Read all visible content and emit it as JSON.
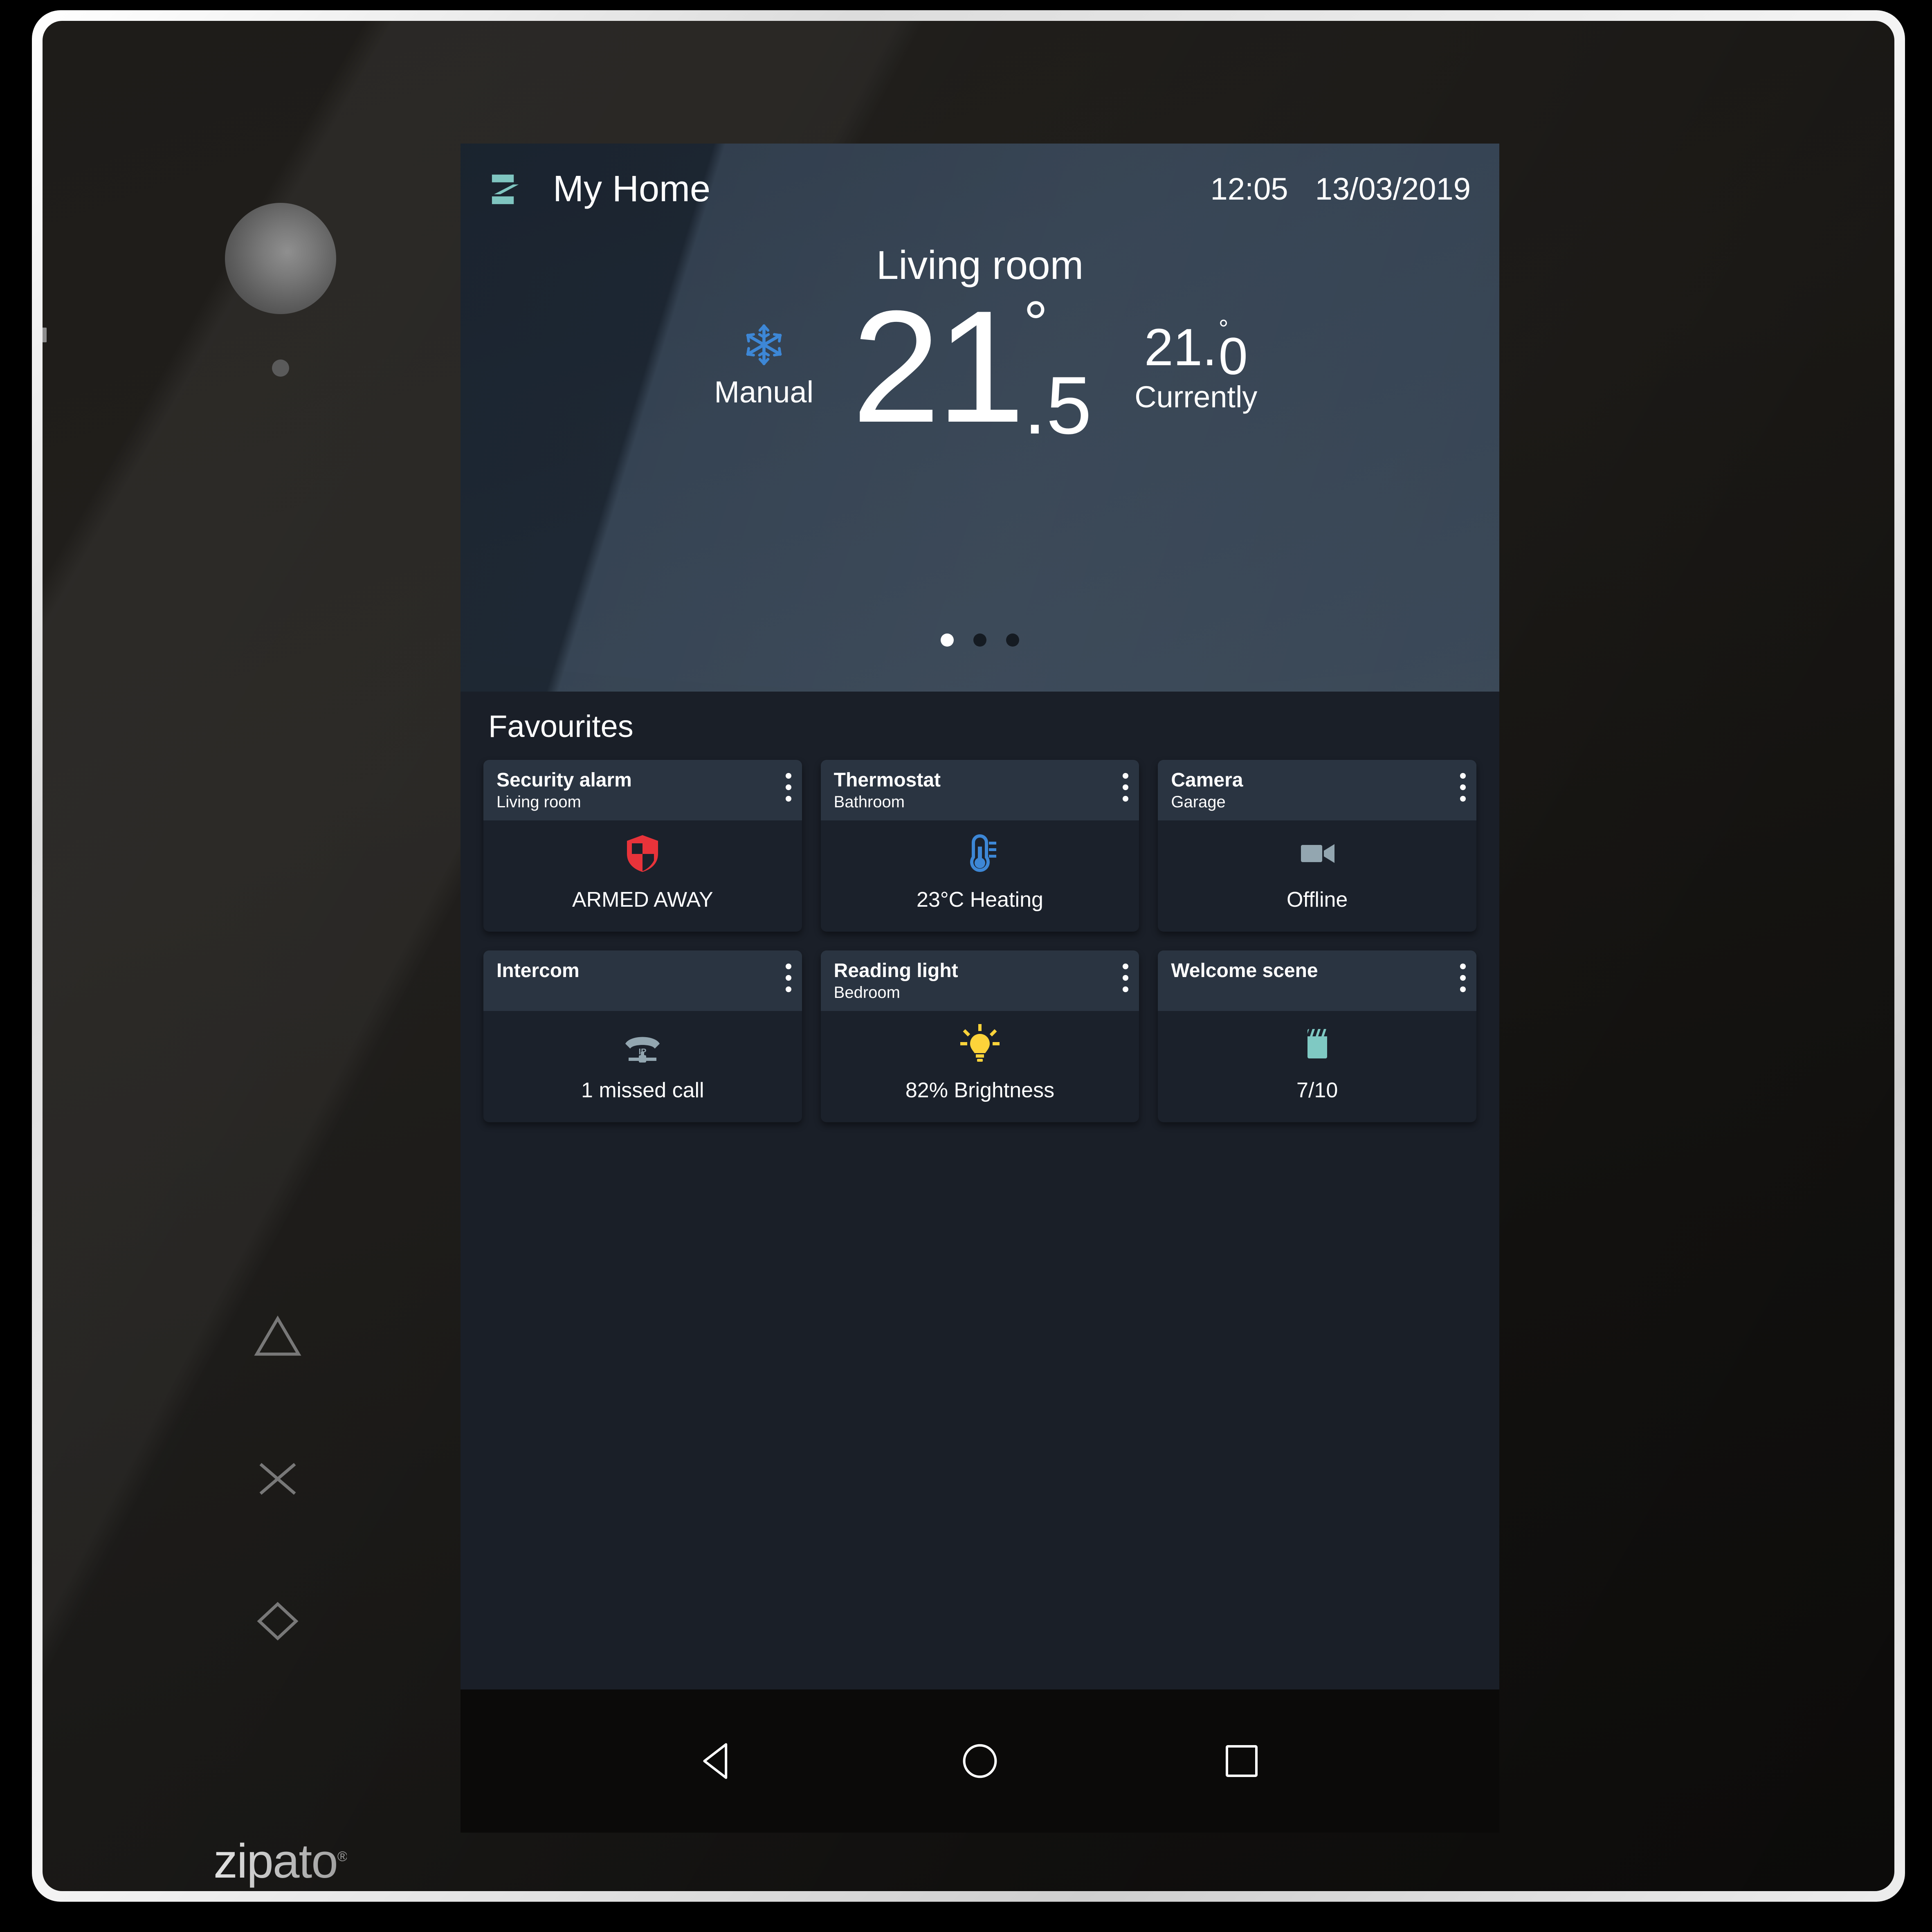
{
  "device": {
    "brand": "zipato",
    "brand_mark": "®",
    "bezel_icons": [
      "triangle-icon",
      "cross-icon",
      "diamond-icon"
    ],
    "sensor": "motion-sensor-dome",
    "led": "status-led"
  },
  "status_bar": {
    "logo": "zipato-z-logo",
    "title": "My Home",
    "time": "12:05",
    "date": "13/03/2019"
  },
  "hero": {
    "room": "Living room",
    "mode_icon": "snowflake-icon",
    "mode_label": "Manual",
    "setpoint": {
      "integer": "21",
      "degree": "°",
      "fraction": ".5"
    },
    "current": {
      "integer": "21.",
      "degree": "°",
      "fraction": "0",
      "label": "Currently"
    },
    "pages": {
      "count": 3,
      "active_index": 0
    }
  },
  "favourites": {
    "section_title": "Favourites",
    "cards": [
      {
        "title": "Security alarm",
        "subtitle": "Living room",
        "icon": "shield-icon",
        "icon_color": "#e8333a",
        "status": "ARMED AWAY",
        "menu": "kebab-menu-icon"
      },
      {
        "title": "Thermostat",
        "subtitle": "Bathroom",
        "icon": "thermometer-icon",
        "icon_color": "#3d87d6",
        "status": "23°C Heating",
        "menu": "kebab-menu-icon"
      },
      {
        "title": "Camera",
        "subtitle": "Garage",
        "icon": "video-camera-icon",
        "icon_color": "#93a6b0",
        "status": "Offline",
        "menu": "kebab-menu-icon"
      },
      {
        "title": "Intercom",
        "subtitle": "",
        "icon": "ip-phone-icon",
        "icon_color": "#93a6b0",
        "status": "1 missed call",
        "menu": "kebab-menu-icon"
      },
      {
        "title": "Reading light",
        "subtitle": "Bedroom",
        "icon": "lightbulb-icon",
        "icon_color": "#fdd33a",
        "status": "82% Brightness",
        "menu": "kebab-menu-icon"
      },
      {
        "title": "Welcome scene",
        "subtitle": "",
        "icon": "clapperboard-icon",
        "icon_color": "#7fc9c3",
        "status": "7/10",
        "menu": "kebab-menu-icon"
      }
    ]
  },
  "nav_bar": {
    "back": "back-triangle-icon",
    "home": "home-circle-icon",
    "recents": "recents-square-icon"
  },
  "colors": {
    "accent_teal": "#7fc5c0",
    "screen_bg": "#1a1f28",
    "card_bg": "#1b212b",
    "card_head_bg": "#2a3441",
    "hero_top": "#2b3747",
    "hero_bottom": "#3a4857"
  }
}
